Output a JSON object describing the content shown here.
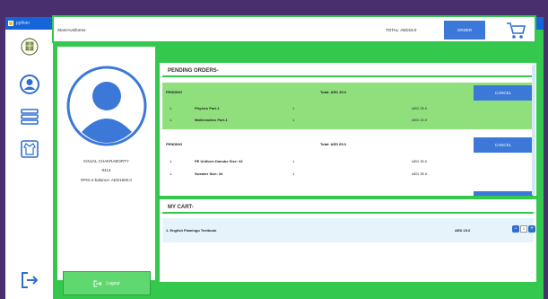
{
  "window": {
    "title": "python"
  },
  "topbar": {
    "breadcrumb": "Store>Uniforms",
    "total": "TOTAL: AED15.0",
    "order_label": "ORDER"
  },
  "profile": {
    "name": "KINJAL CHAKRABORTY",
    "id": "8414",
    "balance": "RFID e-balance: AED1600.0",
    "logout_label": "Logout"
  },
  "pending": {
    "heading": "PENDING ORDERS-",
    "orders": [
      {
        "status": "PENDING",
        "total": "Total: AED 45.0",
        "cancel_label": "CANCEL",
        "items": [
          {
            "no": "1.",
            "name": "Physics Part-1",
            "qty": "1",
            "price": "AED 25.0"
          },
          {
            "no": "1.",
            "name": "Mathematics Part-1",
            "qty": "1",
            "price": "AED 20.0"
          }
        ]
      },
      {
        "status": "PENDING",
        "total": "Total: AED 65.0",
        "cancel_label": "CANCEL",
        "items": [
          {
            "no": "1.",
            "name": "PE Uniform Danube Size: 32",
            "qty": "1",
            "price": "AED 30.0"
          },
          {
            "no": "1.",
            "name": "Sweater Size: 34",
            "qty": "1",
            "price": "AED 35.0"
          }
        ]
      }
    ]
  },
  "cart": {
    "heading": "MY CART-",
    "items": [
      {
        "name": "1. English Flamingo Textbook",
        "price": "AED 15.0",
        "qty": "1"
      }
    ]
  },
  "colors": {
    "accent_green": "#35c84f",
    "pending_bg": "#8fe07d",
    "button_blue": "#3c78d8",
    "sidebar_icon": "#2f6fd0"
  },
  "icons": [
    "school-logo-icon",
    "user-icon",
    "books-icon",
    "uniform-icon",
    "logout-icon",
    "cart-icon"
  ]
}
